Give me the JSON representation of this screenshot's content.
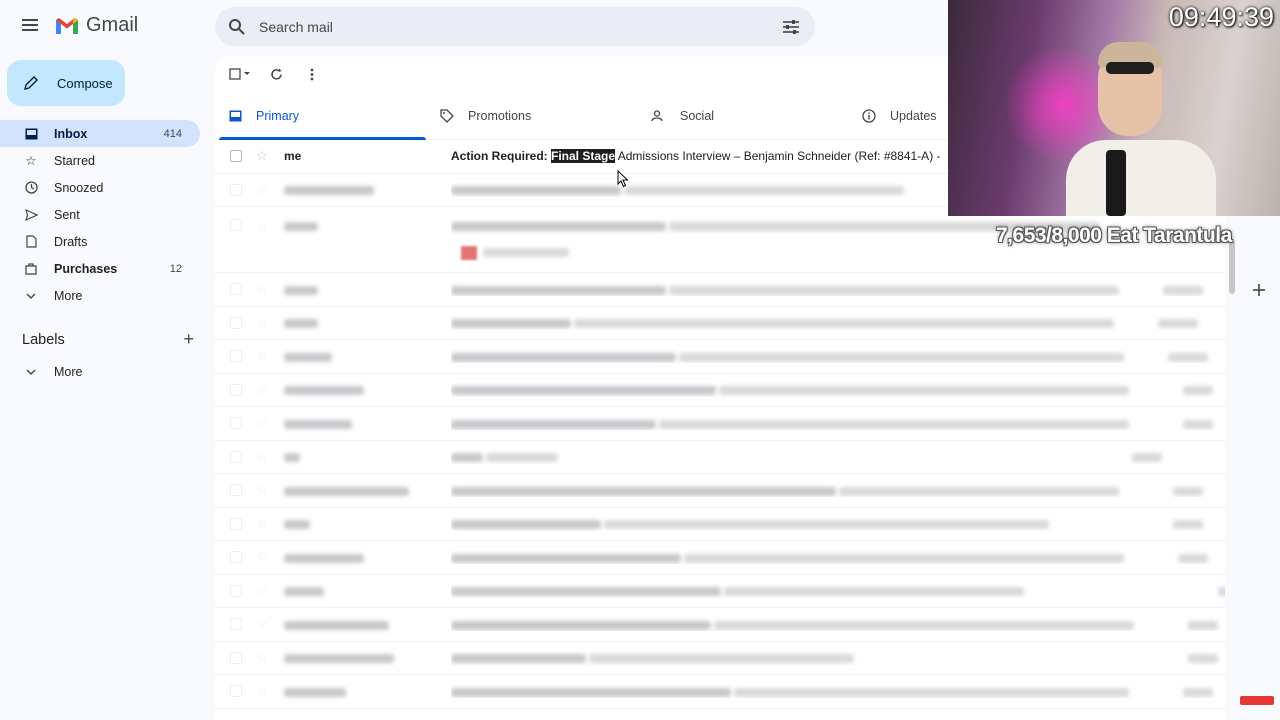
{
  "app": {
    "title": "Gmail"
  },
  "search": {
    "placeholder": "Search mail"
  },
  "compose": {
    "label": "Compose"
  },
  "nav": [
    {
      "label": "Inbox",
      "count": "414",
      "icon": "inbox-icon"
    },
    {
      "label": "Starred",
      "count": "",
      "icon": "star-icon"
    },
    {
      "label": "Snoozed",
      "count": "",
      "icon": "clock-icon"
    },
    {
      "label": "Sent",
      "count": "",
      "icon": "send-icon"
    },
    {
      "label": "Drafts",
      "count": "",
      "icon": "draft-icon"
    },
    {
      "label": "Purchases",
      "count": "12",
      "icon": "bag-icon"
    },
    {
      "label": "More",
      "count": "",
      "icon": "chevron-down-icon"
    }
  ],
  "labels": {
    "title": "Labels",
    "more": "More"
  },
  "tabs": [
    {
      "label": "Primary",
      "icon": "inbox-icon"
    },
    {
      "label": "Promotions",
      "icon": "tag-icon"
    },
    {
      "label": "Social",
      "icon": "people-icon"
    },
    {
      "label": "Updates",
      "icon": "info-icon"
    }
  ],
  "first_email": {
    "sender": "me",
    "subject_prefix": "Action Required: ",
    "subject_highlight": "Final Stage",
    "subject_rest": " Admissions Interview – Benjamin Schneider (Ref: #8841-A) -"
  },
  "overlay": {
    "clock": "09:49:39",
    "goal": "7,653/8,000 Eat Tarantula"
  },
  "colors": {
    "accent": "#0b57d0",
    "compose_bg": "#c2e7ff",
    "active_nav": "#d3e3fd"
  }
}
